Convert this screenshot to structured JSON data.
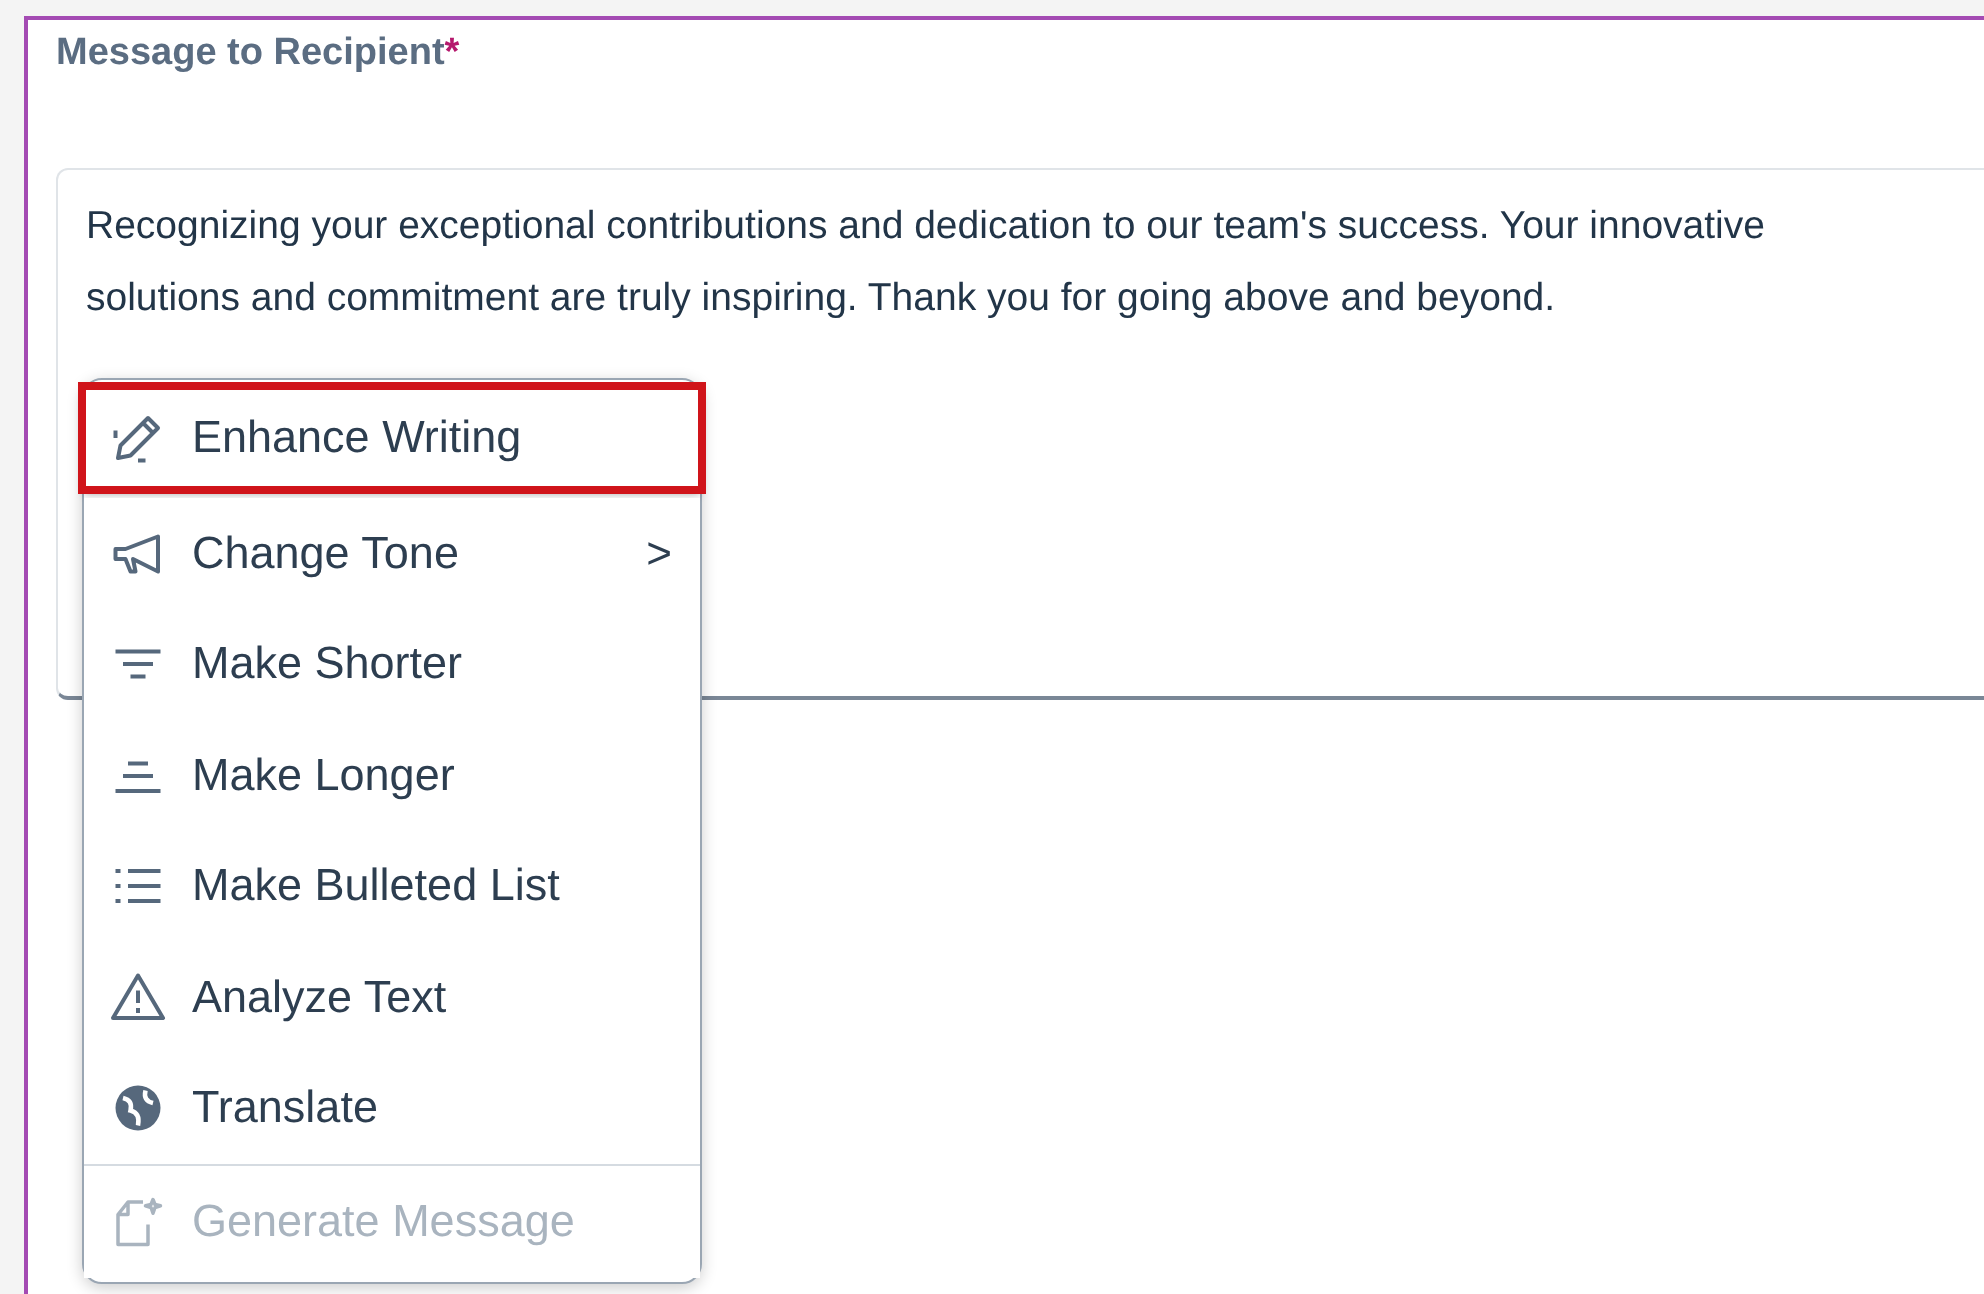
{
  "field": {
    "label": "Message to Recipient",
    "required_mark": "*",
    "value": "Recognizing your exceptional contributions and dedication to our team's success. Your innovative solutions and commitment are truly inspiring. Thank you for going above and beyond."
  },
  "menu": {
    "items": [
      {
        "label": "Enhance Writing",
        "kind": "action",
        "highlighted": true,
        "disabled": false
      },
      {
        "label": "Change Tone",
        "kind": "submenu",
        "chevron": ">",
        "highlighted": false,
        "disabled": false
      },
      {
        "label": "Make Shorter",
        "kind": "action",
        "highlighted": false,
        "disabled": false
      },
      {
        "label": "Make Longer",
        "kind": "action",
        "highlighted": false,
        "disabled": false
      },
      {
        "label": "Make Bulleted List",
        "kind": "action",
        "highlighted": false,
        "disabled": false
      },
      {
        "label": "Analyze Text",
        "kind": "action",
        "highlighted": false,
        "disabled": false
      },
      {
        "label": "Translate",
        "kind": "action",
        "highlighted": false,
        "disabled": false
      },
      {
        "label": "Generate Message",
        "kind": "separated",
        "highlighted": false,
        "disabled": true
      }
    ]
  }
}
